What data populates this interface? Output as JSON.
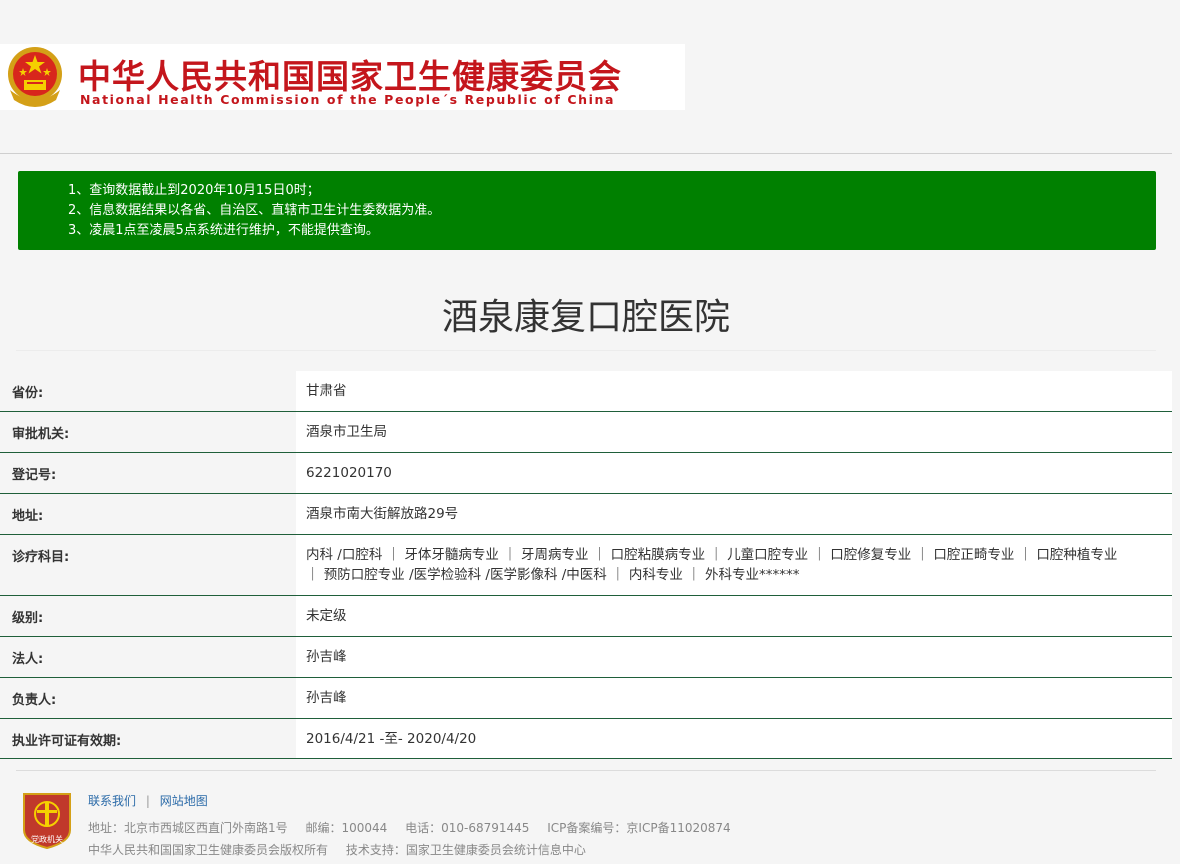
{
  "header": {
    "title_cn": "中华人民共和国国家卫生健康委员会",
    "title_en": "National Health Commission of the People´s Republic of China"
  },
  "notice": [
    "1、查询数据截止到2020年10月15日0时；",
    "2、信息数据结果以各省、自治区、直辖市卫生计生委数据为准。",
    "3、凌晨1点至凌晨5点系统进行维护，不能提供查询。"
  ],
  "hospital_name": "酒泉康复口腔医院",
  "info": {
    "province_label": "省份:",
    "province": "甘肃省",
    "authority_label": "审批机关:",
    "authority": "酒泉市卫生局",
    "reg_label": "登记号:",
    "reg_no": "6221020170",
    "address_label": "地址:",
    "address": "酒泉市南大街解放路29号",
    "dept_label": "诊疗科目:",
    "departments": "内科 /口腔科 ｜ 牙体牙髓病专业 ｜ 牙周病专业 ｜ 口腔粘膜病专业 ｜ 儿童口腔专业 ｜ 口腔修复专业 ｜ 口腔正畸专业 ｜ 口腔种植专业 ｜ 预防口腔专业 /医学检验科 /医学影像科 /中医科 ｜ 内科专业 ｜ 外科专业******",
    "level_label": "级别:",
    "level": "未定级",
    "legal_label": "法人:",
    "legal": "孙吉峰",
    "head_label": "负责人:",
    "head": "孙吉峰",
    "validity_label": "执业许可证有效期:",
    "validity": "2016/4/21 -至- 2020/4/20"
  },
  "footer": {
    "contact": "联系我们",
    "sep": "|",
    "sitemap": "网站地图",
    "address": "地址：北京市西城区西直门外南路1号",
    "postcode": "邮编：100044",
    "phone": "电话：010-68791445",
    "icp": "ICP备案编号：京ICP备11020874",
    "copyright": "中华人民共和国国家卫生健康委员会版权所有",
    "support": "技术支持：国家卫生健康委员会统计信息中心",
    "badge_text": "党政机关"
  },
  "colors": {
    "brand_red": "#c4161c",
    "notice_green": "#008000",
    "row_border": "#1f5f3a"
  },
  "icons": {
    "emblem": "national-emblem-icon",
    "badge": "government-badge-icon"
  }
}
